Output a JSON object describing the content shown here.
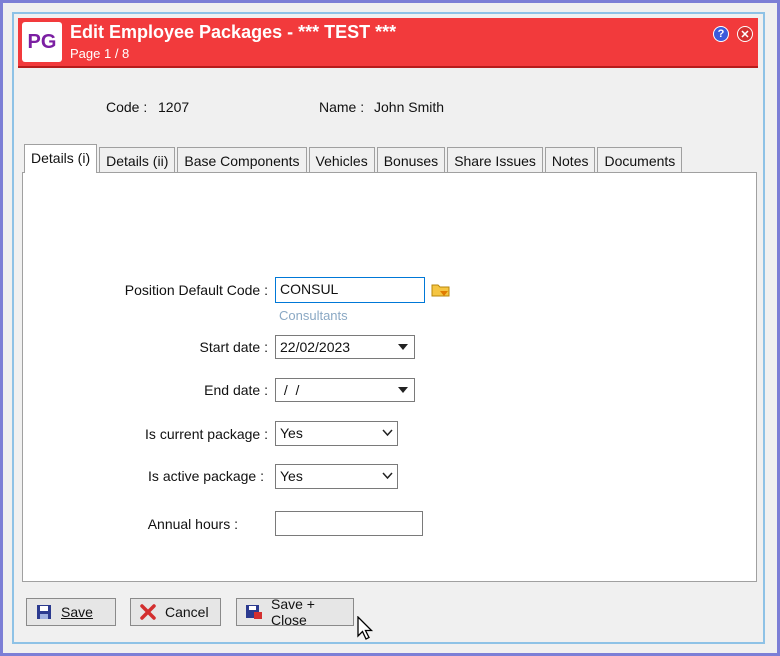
{
  "window": {
    "logo": "PG",
    "title": "Edit Employee Packages - *** TEST ***",
    "subtitle": "Page 1 / 8",
    "help_icon": "?",
    "close_icon": "✕"
  },
  "header": {
    "code_label": "Code :",
    "code_value": "1207",
    "name_label": "Name :",
    "name_value": "John Smith"
  },
  "tabs": [
    "Details (i)",
    "Details (ii)",
    "Base Components",
    "Vehicles",
    "Bonuses",
    "Share Issues",
    "Notes",
    "Documents"
  ],
  "form": {
    "position_label": "Position Default Code :",
    "position_value": "CONSUL",
    "position_description": "Consultants",
    "start_label": "Start date :",
    "start_value": "22/02/2023",
    "end_label": "End date :",
    "end_value": " /  /",
    "current_label": "Is current package :",
    "current_value": "Yes",
    "active_label": "Is active package :",
    "active_value": "Yes",
    "hours_label": "Annual hours :",
    "hours_value": ""
  },
  "buttons": {
    "save": "Save",
    "cancel": "Cancel",
    "save_close": "Save + Close"
  },
  "colors": {
    "titlebar": "#f23a3c",
    "accent_border": "#7c7fd6"
  }
}
